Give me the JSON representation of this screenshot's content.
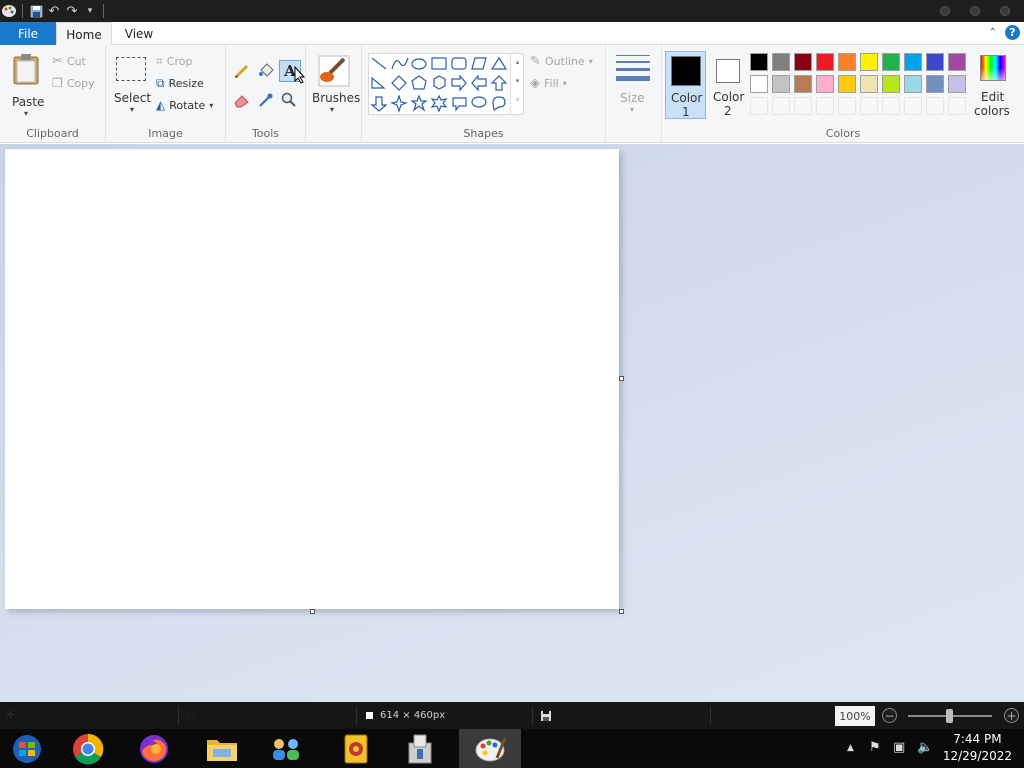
{
  "app": {
    "quick_access": [
      "paint-app-icon",
      "save-icon",
      "undo-icon",
      "redo-icon",
      "customize-qa-icon"
    ]
  },
  "tabs": {
    "file": "File",
    "home": "Home",
    "view": "View"
  },
  "ribbon": {
    "clipboard": {
      "label": "Clipboard",
      "paste": "Paste",
      "cut": "Cut",
      "copy": "Copy"
    },
    "image": {
      "label": "Image",
      "select": "Select",
      "crop": "Crop",
      "resize": "Resize",
      "rotate": "Rotate"
    },
    "tools": {
      "label": "Tools"
    },
    "brushes": {
      "label": "Brushes"
    },
    "shapes": {
      "label": "Shapes",
      "outline": "Outline",
      "fill": "Fill"
    },
    "size": {
      "label": "Size"
    },
    "colors": {
      "label": "Colors",
      "color1": "Color 1",
      "color1_line1": "Color",
      "color1_line2": "1",
      "color2_line1": "Color",
      "color2_line2": "2",
      "edit_line1": "Edit",
      "edit_line2": "colors",
      "color1_value": "#000000",
      "color2_value": "#ffffff",
      "row1": [
        "#000000",
        "#7f7f7f",
        "#880015",
        "#ed1c24",
        "#ff7f27",
        "#fff200",
        "#22b14c",
        "#00a2e8",
        "#3f48cc",
        "#a349a4"
      ],
      "row2": [
        "#ffffff",
        "#c3c3c3",
        "#b97a57",
        "#ffaec9",
        "#ffc90e",
        "#efe4b0",
        "#b5e61d",
        "#99d9ea",
        "#7092be",
        "#c8bfe7"
      ]
    }
  },
  "status": {
    "canvas_size": "614 × 460px",
    "zoom": "100%"
  },
  "taskbar": {
    "apps": [
      "windows-start-icon",
      "chrome-icon",
      "firefox-icon",
      "file-explorer-icon",
      "network-people-icon",
      "mahjong-icon",
      "installer-icon",
      "paint-icon"
    ],
    "time": "7:44 PM",
    "date": "12/29/2022"
  }
}
